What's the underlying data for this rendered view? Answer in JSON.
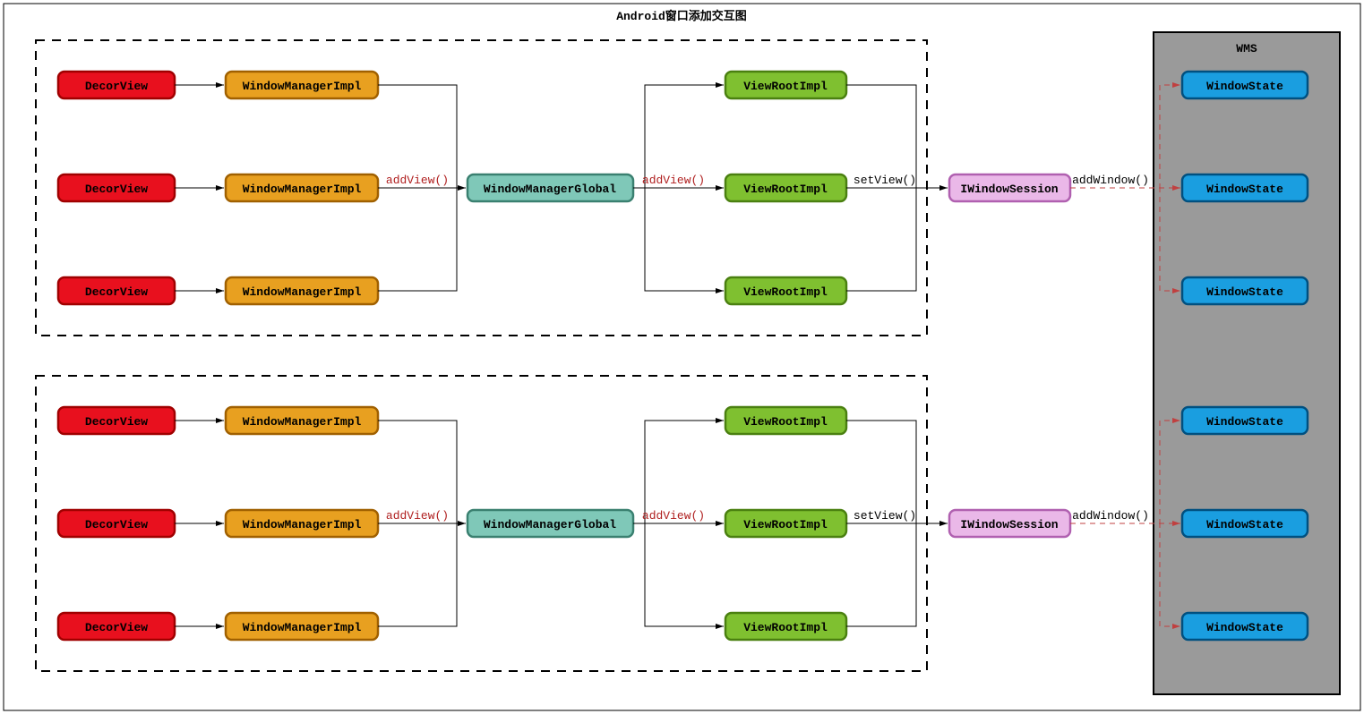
{
  "title": "Android窗口添加交互图",
  "wms_label": "WMS",
  "labels": {
    "decor": "DecorView",
    "wmi": "WindowManagerImpl",
    "wmg": "WindowManagerGlobal",
    "vri": "ViewRootImpl",
    "iws": "IWindowSession",
    "ws": "WindowState"
  },
  "edges": {
    "addView": "addView()",
    "setView": "setView()",
    "addWindow": "addWindow()"
  },
  "colors": {
    "decor_fill": "#e8101e",
    "decor_stroke": "#a00000",
    "wmi_fill": "#e8a020",
    "wmi_stroke": "#a06000",
    "wmg_fill": "#7fc8b8",
    "wmg_stroke": "#3a8070",
    "vri_fill": "#7fc030",
    "vri_stroke": "#4a8010",
    "iws_fill": "#eab8e8",
    "iws_stroke": "#b060b0",
    "ws_fill": "#1a9ee0",
    "ws_stroke": "#005080",
    "wms_fill": "#9a9a9a",
    "wms_stroke": "#000000",
    "red_text": "#b02020",
    "red_dashed": "#c04040"
  }
}
